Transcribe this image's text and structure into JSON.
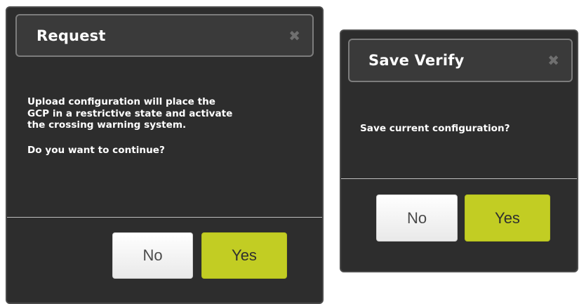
{
  "colors": {
    "dialog_background": "#2d2d2d",
    "title_bar_background": "#3a3a3a",
    "yes_button": "#c2cd23",
    "no_button": "#f2f2f2",
    "text": "#ffffff"
  },
  "request_dialog": {
    "title": "Request",
    "close_icon": "✖",
    "message_lines": [
      "Upload configuration will place the",
      "GCP in a restrictive state and activate",
      "the crossing warning system."
    ],
    "question": "Do you want to continue?",
    "no_label": "No",
    "yes_label": "Yes"
  },
  "save_verify_dialog": {
    "title": "Save Verify",
    "close_icon": "✖",
    "message": "Save current configuration?",
    "no_label": "No",
    "yes_label": "Yes"
  }
}
